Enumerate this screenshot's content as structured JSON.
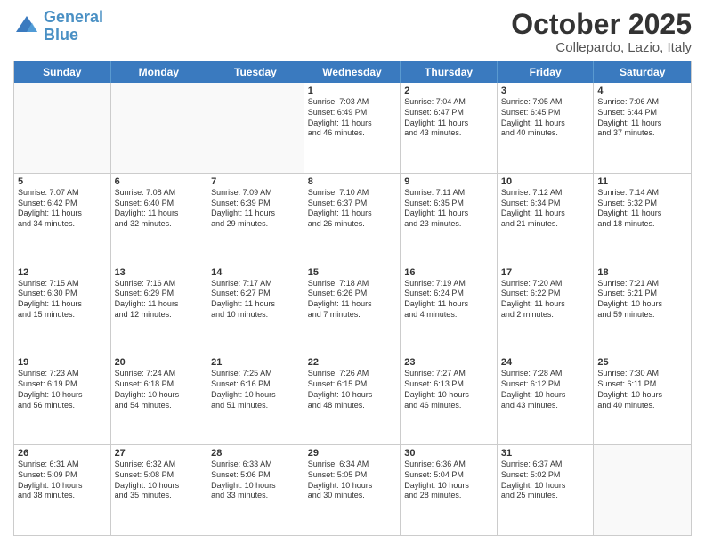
{
  "logo": {
    "line1": "General",
    "line2": "Blue"
  },
  "title": "October 2025",
  "subtitle": "Collepardo, Lazio, Italy",
  "header_days": [
    "Sunday",
    "Monday",
    "Tuesday",
    "Wednesday",
    "Thursday",
    "Friday",
    "Saturday"
  ],
  "rows": [
    [
      {
        "num": "",
        "lines": [],
        "empty": true
      },
      {
        "num": "",
        "lines": [],
        "empty": true
      },
      {
        "num": "",
        "lines": [],
        "empty": true
      },
      {
        "num": "1",
        "lines": [
          "Sunrise: 7:03 AM",
          "Sunset: 6:49 PM",
          "Daylight: 11 hours",
          "and 46 minutes."
        ]
      },
      {
        "num": "2",
        "lines": [
          "Sunrise: 7:04 AM",
          "Sunset: 6:47 PM",
          "Daylight: 11 hours",
          "and 43 minutes."
        ]
      },
      {
        "num": "3",
        "lines": [
          "Sunrise: 7:05 AM",
          "Sunset: 6:45 PM",
          "Daylight: 11 hours",
          "and 40 minutes."
        ]
      },
      {
        "num": "4",
        "lines": [
          "Sunrise: 7:06 AM",
          "Sunset: 6:44 PM",
          "Daylight: 11 hours",
          "and 37 minutes."
        ]
      }
    ],
    [
      {
        "num": "5",
        "lines": [
          "Sunrise: 7:07 AM",
          "Sunset: 6:42 PM",
          "Daylight: 11 hours",
          "and 34 minutes."
        ]
      },
      {
        "num": "6",
        "lines": [
          "Sunrise: 7:08 AM",
          "Sunset: 6:40 PM",
          "Daylight: 11 hours",
          "and 32 minutes."
        ]
      },
      {
        "num": "7",
        "lines": [
          "Sunrise: 7:09 AM",
          "Sunset: 6:39 PM",
          "Daylight: 11 hours",
          "and 29 minutes."
        ]
      },
      {
        "num": "8",
        "lines": [
          "Sunrise: 7:10 AM",
          "Sunset: 6:37 PM",
          "Daylight: 11 hours",
          "and 26 minutes."
        ]
      },
      {
        "num": "9",
        "lines": [
          "Sunrise: 7:11 AM",
          "Sunset: 6:35 PM",
          "Daylight: 11 hours",
          "and 23 minutes."
        ]
      },
      {
        "num": "10",
        "lines": [
          "Sunrise: 7:12 AM",
          "Sunset: 6:34 PM",
          "Daylight: 11 hours",
          "and 21 minutes."
        ]
      },
      {
        "num": "11",
        "lines": [
          "Sunrise: 7:14 AM",
          "Sunset: 6:32 PM",
          "Daylight: 11 hours",
          "and 18 minutes."
        ]
      }
    ],
    [
      {
        "num": "12",
        "lines": [
          "Sunrise: 7:15 AM",
          "Sunset: 6:30 PM",
          "Daylight: 11 hours",
          "and 15 minutes."
        ]
      },
      {
        "num": "13",
        "lines": [
          "Sunrise: 7:16 AM",
          "Sunset: 6:29 PM",
          "Daylight: 11 hours",
          "and 12 minutes."
        ]
      },
      {
        "num": "14",
        "lines": [
          "Sunrise: 7:17 AM",
          "Sunset: 6:27 PM",
          "Daylight: 11 hours",
          "and 10 minutes."
        ]
      },
      {
        "num": "15",
        "lines": [
          "Sunrise: 7:18 AM",
          "Sunset: 6:26 PM",
          "Daylight: 11 hours",
          "and 7 minutes."
        ]
      },
      {
        "num": "16",
        "lines": [
          "Sunrise: 7:19 AM",
          "Sunset: 6:24 PM",
          "Daylight: 11 hours",
          "and 4 minutes."
        ]
      },
      {
        "num": "17",
        "lines": [
          "Sunrise: 7:20 AM",
          "Sunset: 6:22 PM",
          "Daylight: 11 hours",
          "and 2 minutes."
        ]
      },
      {
        "num": "18",
        "lines": [
          "Sunrise: 7:21 AM",
          "Sunset: 6:21 PM",
          "Daylight: 10 hours",
          "and 59 minutes."
        ]
      }
    ],
    [
      {
        "num": "19",
        "lines": [
          "Sunrise: 7:23 AM",
          "Sunset: 6:19 PM",
          "Daylight: 10 hours",
          "and 56 minutes."
        ]
      },
      {
        "num": "20",
        "lines": [
          "Sunrise: 7:24 AM",
          "Sunset: 6:18 PM",
          "Daylight: 10 hours",
          "and 54 minutes."
        ]
      },
      {
        "num": "21",
        "lines": [
          "Sunrise: 7:25 AM",
          "Sunset: 6:16 PM",
          "Daylight: 10 hours",
          "and 51 minutes."
        ]
      },
      {
        "num": "22",
        "lines": [
          "Sunrise: 7:26 AM",
          "Sunset: 6:15 PM",
          "Daylight: 10 hours",
          "and 48 minutes."
        ]
      },
      {
        "num": "23",
        "lines": [
          "Sunrise: 7:27 AM",
          "Sunset: 6:13 PM",
          "Daylight: 10 hours",
          "and 46 minutes."
        ]
      },
      {
        "num": "24",
        "lines": [
          "Sunrise: 7:28 AM",
          "Sunset: 6:12 PM",
          "Daylight: 10 hours",
          "and 43 minutes."
        ]
      },
      {
        "num": "25",
        "lines": [
          "Sunrise: 7:30 AM",
          "Sunset: 6:11 PM",
          "Daylight: 10 hours",
          "and 40 minutes."
        ]
      }
    ],
    [
      {
        "num": "26",
        "lines": [
          "Sunrise: 6:31 AM",
          "Sunset: 5:09 PM",
          "Daylight: 10 hours",
          "and 38 minutes."
        ]
      },
      {
        "num": "27",
        "lines": [
          "Sunrise: 6:32 AM",
          "Sunset: 5:08 PM",
          "Daylight: 10 hours",
          "and 35 minutes."
        ]
      },
      {
        "num": "28",
        "lines": [
          "Sunrise: 6:33 AM",
          "Sunset: 5:06 PM",
          "Daylight: 10 hours",
          "and 33 minutes."
        ]
      },
      {
        "num": "29",
        "lines": [
          "Sunrise: 6:34 AM",
          "Sunset: 5:05 PM",
          "Daylight: 10 hours",
          "and 30 minutes."
        ]
      },
      {
        "num": "30",
        "lines": [
          "Sunrise: 6:36 AM",
          "Sunset: 5:04 PM",
          "Daylight: 10 hours",
          "and 28 minutes."
        ]
      },
      {
        "num": "31",
        "lines": [
          "Sunrise: 6:37 AM",
          "Sunset: 5:02 PM",
          "Daylight: 10 hours",
          "and 25 minutes."
        ]
      },
      {
        "num": "",
        "lines": [],
        "empty": true
      }
    ]
  ]
}
